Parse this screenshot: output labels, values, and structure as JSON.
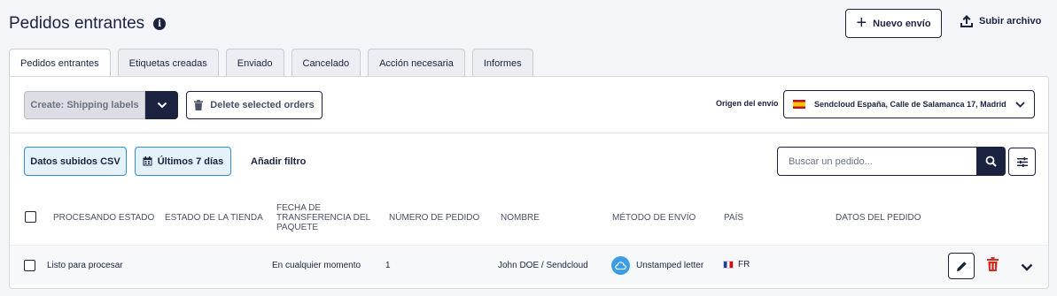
{
  "header": {
    "title": "Pedidos entrantes",
    "new_shipment_label": "Nuevo envío",
    "upload_label": "Subir archivo"
  },
  "tabs": [
    {
      "label": "Pedidos entrantes",
      "active": true
    },
    {
      "label": "Etiquetas creadas",
      "active": false
    },
    {
      "label": "Enviado",
      "active": false
    },
    {
      "label": "Cancelado",
      "active": false
    },
    {
      "label": "Acción necesaria",
      "active": false
    },
    {
      "label": "Informes",
      "active": false
    }
  ],
  "toolbar": {
    "create_label": "Create: Shipping labels",
    "delete_label": "Delete selected orders",
    "origin_label": "Origen del envío",
    "origin_value": "Sendcloud España, Calle de Salamanca 17, Madrid"
  },
  "filters": {
    "csv_chip": "Datos subidos CSV",
    "date_chip": "Últimos 7 días",
    "add_filter": "Añadir filtro",
    "search_placeholder": "Buscar un pedido..."
  },
  "table": {
    "headers": {
      "status": "PROCESANDO ESTADO",
      "store_status": "ESTADO DE LA TIENDA",
      "transfer_date": "FECHA DE TRANSFERENCIA DEL PAQUETE",
      "order_number": "NÚMERO DE PEDIDO",
      "name": "NOMBRE",
      "method": "MÉTODO DE ENVÍO",
      "country": "PAÍS",
      "order_data": "DATOS DEL PEDIDO"
    },
    "rows": [
      {
        "status": "Listo para procesar",
        "transfer_date": "En cualquier momento",
        "order_number": "1",
        "name": "John DOE / Sendcloud",
        "method": "Unstamped letter",
        "country": "FR"
      }
    ]
  },
  "colors": {
    "navy": "#1a2240",
    "accent_blue": "#2e8fd6",
    "delete_red": "#d42b1f"
  }
}
